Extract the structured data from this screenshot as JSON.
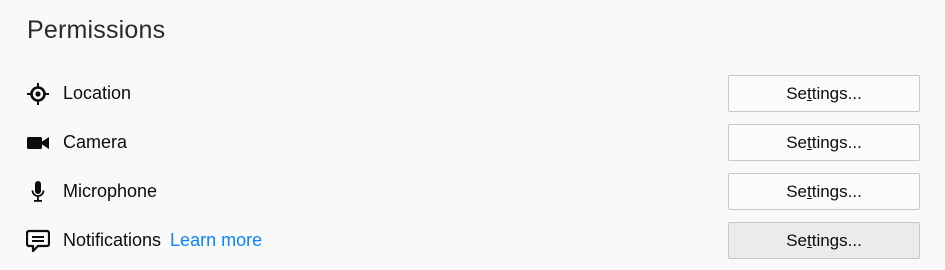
{
  "section": {
    "title": "Permissions"
  },
  "permissions": [
    {
      "label": "Location",
      "icon": "location-icon",
      "button_label": "Settings...",
      "access_key": "t"
    },
    {
      "label": "Camera",
      "icon": "camera-icon",
      "button_label": "Settings...",
      "access_key": "t"
    },
    {
      "label": "Microphone",
      "icon": "microphone-icon",
      "button_label": "Settings...",
      "access_key": "t"
    },
    {
      "label": "Notifications",
      "icon": "notifications-icon",
      "learn_more": "Learn more",
      "button_label": "Settings...",
      "access_key": "t"
    }
  ],
  "colors": {
    "background": "#f9f9fa",
    "link": "#0a84ff",
    "button_border": "#c8c8cc",
    "button_hover_bg": "#ebebeb"
  }
}
